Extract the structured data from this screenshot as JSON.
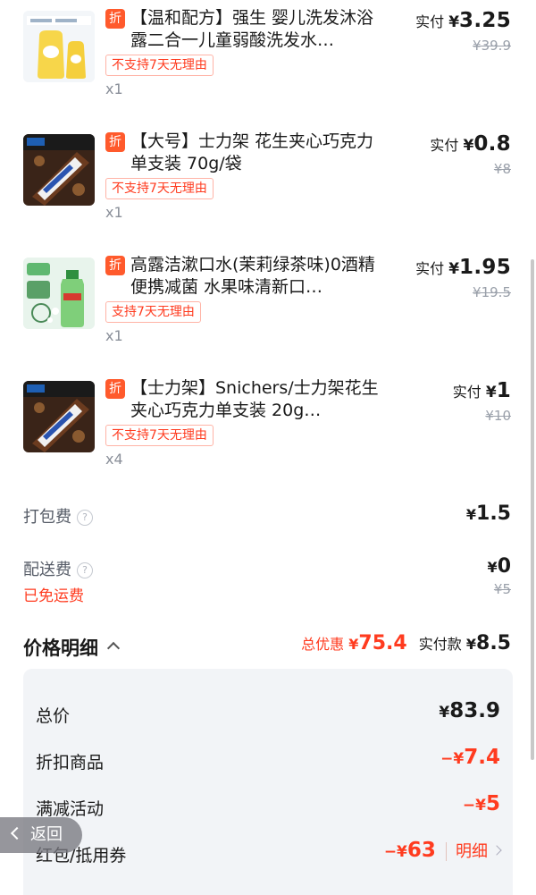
{
  "items": [
    {
      "title": "【温和配方】强生 婴儿洗发沐浴露二合一儿童弱酸洗发水…",
      "discount_badge": "折",
      "tag": "不支持7天无理由",
      "qty": "x1",
      "paid_label": "实付",
      "paid_yen": "¥",
      "paid_amount": "3.25",
      "original_price": "¥39.9",
      "thumb_icon": "baby-shampoo-product-icon"
    },
    {
      "title": "【大号】士力架 花生夹心巧克力单支装 70g/袋",
      "discount_badge": "折",
      "tag": "不支持7天无理由",
      "qty": "x1",
      "paid_label": "实付",
      "paid_yen": "¥",
      "paid_amount": "0.8",
      "original_price": "¥8",
      "thumb_icon": "snickers-product-icon"
    },
    {
      "title": "高露洁漱口水(茉莉绿茶味)0酒精 便携减菌 水果味清新口…",
      "discount_badge": "折",
      "tag": "支持7天无理由",
      "qty": "x1",
      "paid_label": "实付",
      "paid_yen": "¥",
      "paid_amount": "1.95",
      "original_price": "¥19.5",
      "thumb_icon": "mouthwash-product-icon"
    },
    {
      "title": "【士力架】Snichers/士力架花生夹心巧克力单支装 20g…",
      "discount_badge": "折",
      "tag": "不支持7天无理由",
      "qty": "x4",
      "paid_label": "实付",
      "paid_yen": "¥",
      "paid_amount": "1",
      "original_price": "¥10",
      "thumb_icon": "snickers-product-icon"
    }
  ],
  "fees": {
    "packing_label": "打包费",
    "packing_yen": "¥",
    "packing_amount": "1.5",
    "delivery_label": "配送费",
    "delivery_yen": "¥",
    "delivery_amount": "0",
    "delivery_original": "¥5",
    "free_shipping": "已免运费",
    "help_glyph": "?"
  },
  "price_detail": {
    "title": "价格明细",
    "total_discount_label": "总优惠",
    "total_discount_yen": "¥",
    "total_discount_amount": "75.4",
    "paid_label": "实付款",
    "paid_yen": "¥",
    "paid_amount": "8.5",
    "rows": [
      {
        "label": "总价",
        "prefix": "¥",
        "amount": "83.9"
      },
      {
        "label": "折扣商品",
        "prefix": "−¥",
        "amount": "7.4"
      },
      {
        "label": "满减活动",
        "prefix": "−¥",
        "amount": "5"
      },
      {
        "label": "红包/抵用券",
        "prefix": "−¥",
        "amount": "63",
        "link": "明细"
      }
    ]
  },
  "back_button": {
    "label": "返回"
  },
  "colors": {
    "accent_red": "#ff3b1f",
    "badge_orange": "#ff5a2c",
    "panel_bg": "#f2f4f7"
  }
}
